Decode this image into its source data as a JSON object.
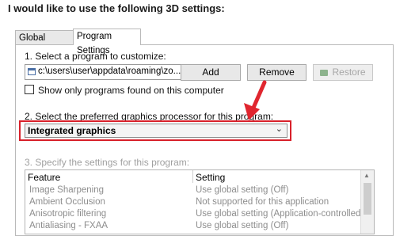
{
  "heading": "I would like to use the following 3D settings:",
  "tabs": [
    "Global Settings",
    "Program Settings"
  ],
  "step1": {
    "label": "1. Select a program to customize:",
    "program_path": "c:\\users\\user\\appdata\\roaming\\zo...",
    "buttons": {
      "add": "Add",
      "remove": "Remove",
      "restore": "Restore"
    },
    "checkbox_label": "Show only programs found on this computer"
  },
  "step2": {
    "label": "2. Select the preferred graphics processor for this program:",
    "selected": "Integrated graphics"
  },
  "step3": {
    "label": "3. Specify the settings for this program:",
    "columns": [
      "Feature",
      "Setting"
    ],
    "rows": [
      {
        "feature": "Image Sharpening",
        "setting": "Use global setting (Off)"
      },
      {
        "feature": "Ambient Occlusion",
        "setting": "Not supported for this application"
      },
      {
        "feature": "Anisotropic filtering",
        "setting": "Use global setting (Application-controlled)"
      },
      {
        "feature": "Antialiasing - FXAA",
        "setting": "Use global setting (Off)"
      }
    ]
  },
  "colors": {
    "highlight": "#d8202a"
  },
  "icons": [
    "program-window-icon",
    "nvidia-icon",
    "chevron-down-icon",
    "red-arrow-icon"
  ]
}
